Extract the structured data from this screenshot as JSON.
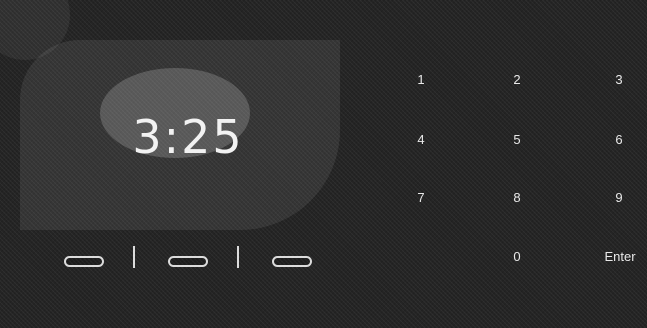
{
  "clock": {
    "time": "3:25"
  },
  "pin": {
    "slots": 3
  },
  "keypad": {
    "keys": [
      "1",
      "2",
      "3",
      "4",
      "5",
      "6",
      "7",
      "8",
      "9",
      "0",
      "Enter"
    ]
  }
}
